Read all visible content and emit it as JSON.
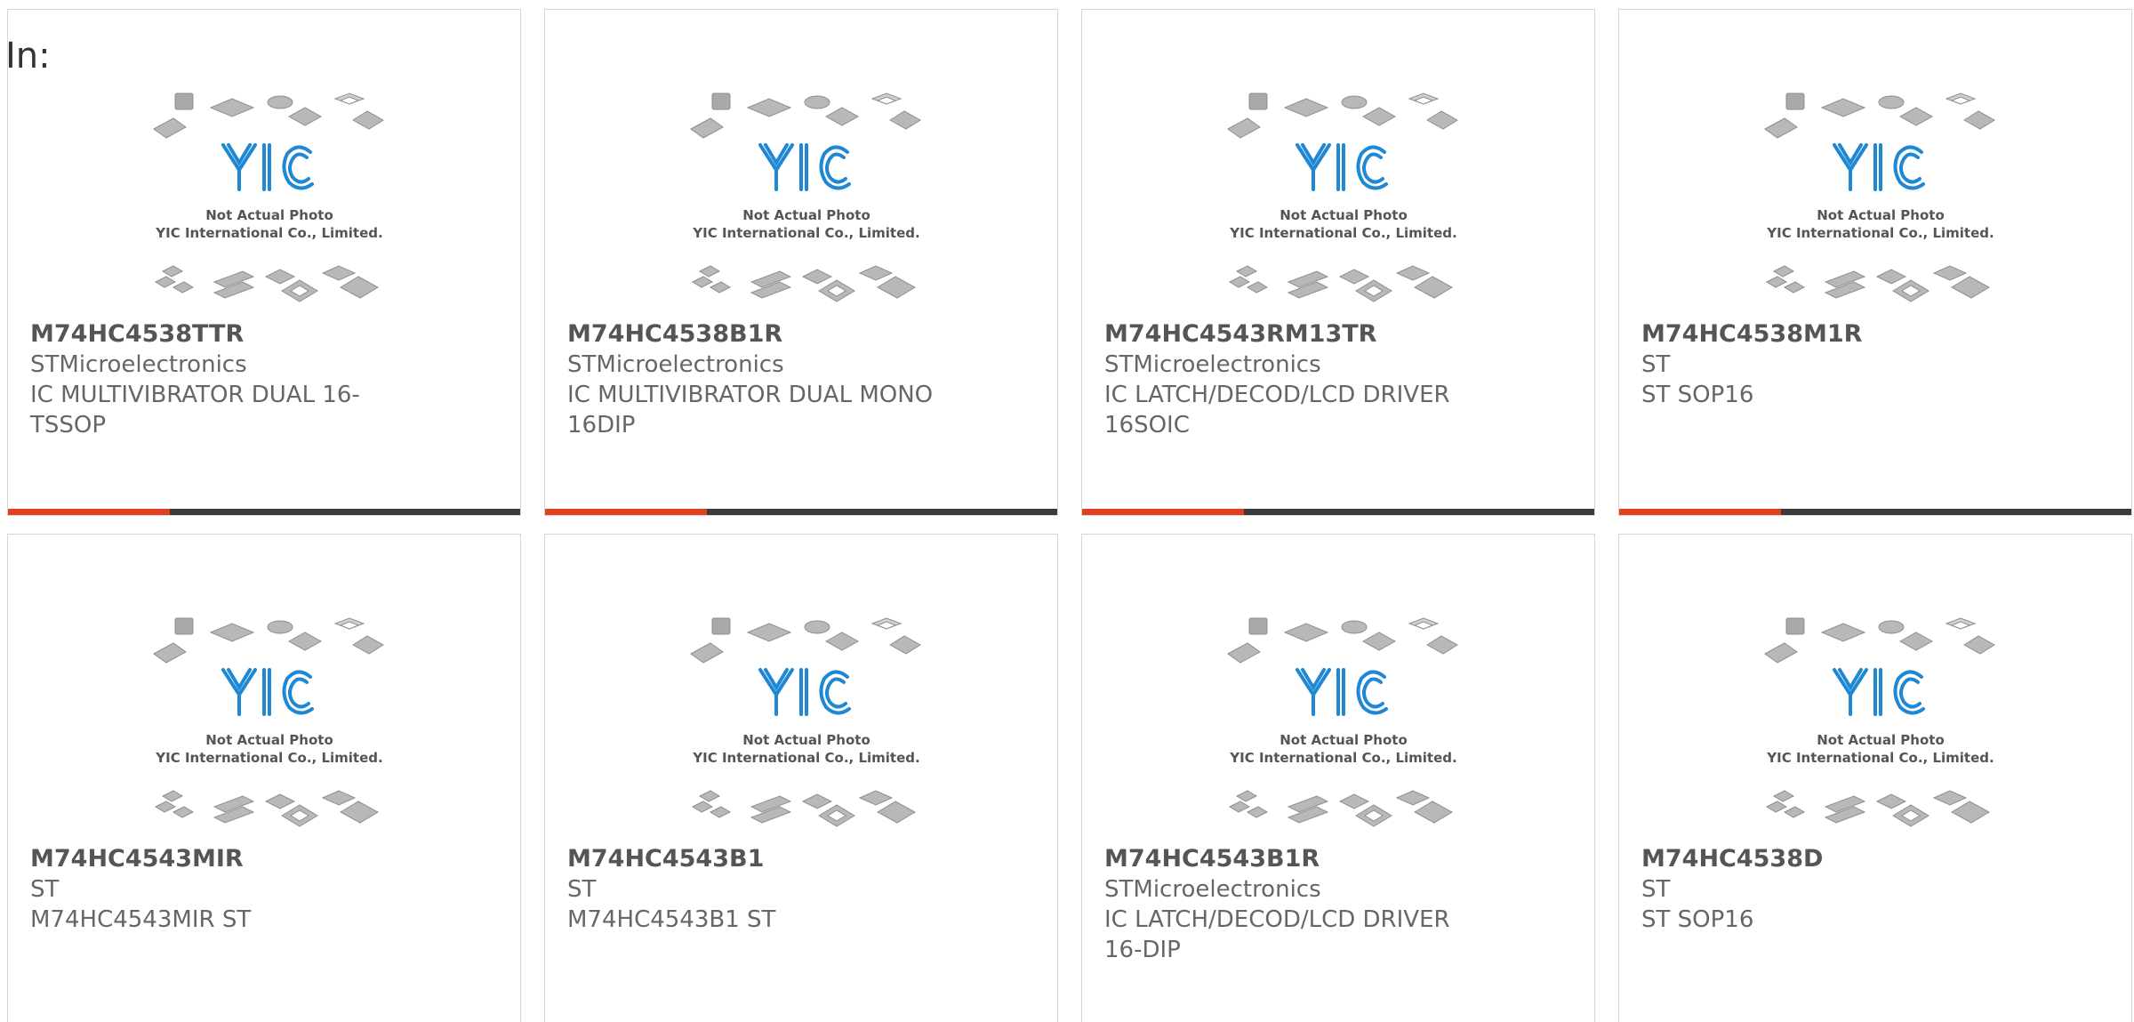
{
  "header": {
    "label": "In:"
  },
  "photo": {
    "brand": "YIC",
    "caption_line1": "Not Actual Photo",
    "caption_line2": "YIC International Co., Limited."
  },
  "colors": {
    "accent": "#e0401e",
    "bar": "#3a3a3a",
    "logo": "#1e88d4",
    "chip": "#b8b8b8"
  },
  "products": [
    {
      "part": "M74HC4538TTR",
      "maker": "STMicroelectronics",
      "desc": "IC MULTIVIBRATOR DUAL 16-TSSOP"
    },
    {
      "part": "M74HC4538B1R",
      "maker": "STMicroelectronics",
      "desc": "IC MULTIVIBRATOR DUAL MONO 16DIP"
    },
    {
      "part": "M74HC4543RM13TR",
      "maker": "STMicroelectronics",
      "desc": "IC LATCH/DECOD/LCD DRIVER 16SOIC"
    },
    {
      "part": "M74HC4538M1R",
      "maker": "ST",
      "desc": "ST SOP16"
    },
    {
      "part": "M74HC4543MIR",
      "maker": "ST",
      "desc": "M74HC4543MIR ST"
    },
    {
      "part": "M74HC4543B1",
      "maker": "ST",
      "desc": "M74HC4543B1 ST"
    },
    {
      "part": "M74HC4543B1R",
      "maker": "STMicroelectronics",
      "desc": "IC LATCH/DECOD/LCD DRIVER 16-DIP"
    },
    {
      "part": "M74HC4538D",
      "maker": "ST",
      "desc": "ST SOP16"
    }
  ]
}
